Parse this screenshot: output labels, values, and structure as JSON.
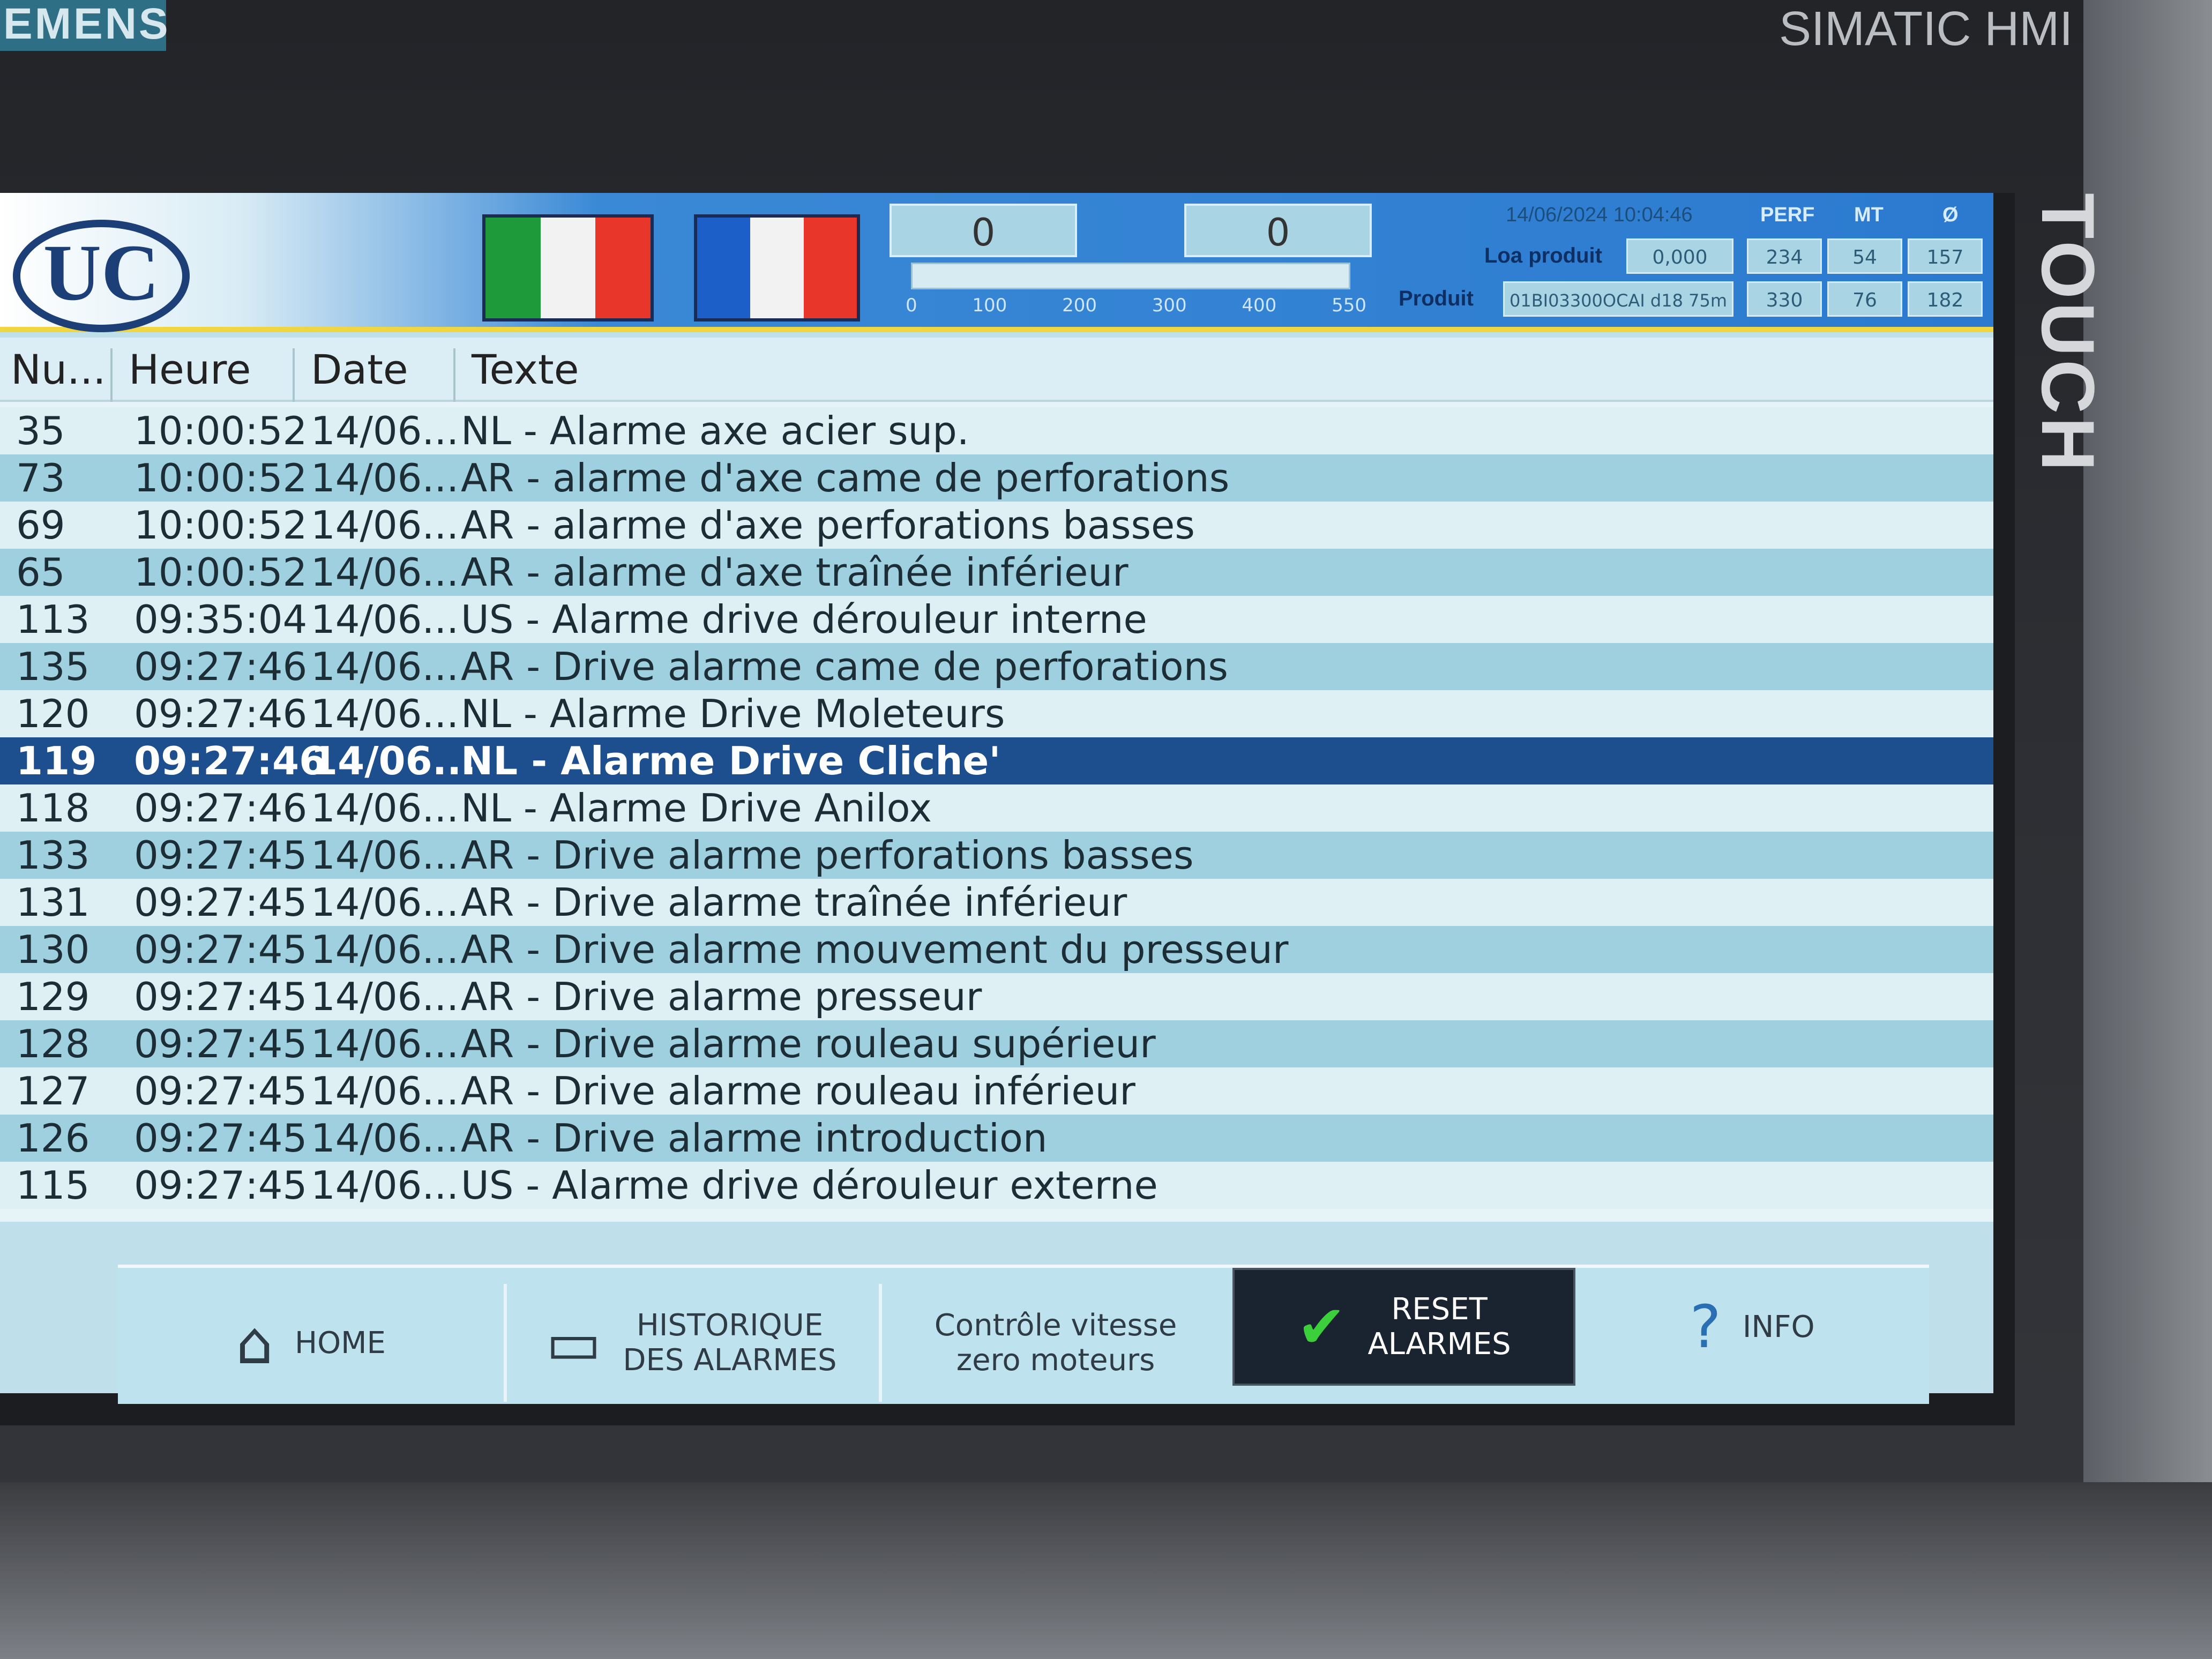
{
  "device": {
    "brand_left": "EMENS",
    "brand_right": "SIMATIC HMI",
    "touch_label": "TOUCH"
  },
  "header": {
    "logo_text": "UC",
    "counters": [
      "0",
      "0"
    ],
    "scale_ticks": [
      "0",
      "100",
      "200",
      "300",
      "400",
      "550"
    ],
    "datetime": "14/06/2024 10:04:46",
    "col_labels": [
      "PERF",
      "MT",
      "Ø"
    ],
    "loa_label": "Loa produit",
    "loa_value": "0,000",
    "produit_label": "Produit",
    "produit_value": "01BI03300OCAI d18 75m",
    "row1": [
      "234",
      "54",
      "157"
    ],
    "row2": [
      "330",
      "76",
      "182"
    ],
    "flag_colors": {
      "it": [
        "#1f9a3a",
        "#f2f2f2",
        "#e8372a"
      ],
      "fr": [
        "#1d5fc9",
        "#f2f2f2",
        "#e8372a"
      ]
    }
  },
  "table": {
    "columns": [
      "Nu...",
      "Heure",
      "Date",
      "Texte"
    ],
    "selected_index": 7,
    "rows": [
      {
        "num": "35",
        "time": "10:00:52",
        "date": "14/06...",
        "text": "NL - Alarme axe acier sup."
      },
      {
        "num": "73",
        "time": "10:00:52",
        "date": "14/06...",
        "text": "AR - alarme d'axe came de perforations"
      },
      {
        "num": "69",
        "time": "10:00:52",
        "date": "14/06...",
        "text": "AR - alarme d'axe perforations basses"
      },
      {
        "num": "65",
        "time": "10:00:52",
        "date": "14/06...",
        "text": "AR - alarme d'axe  traînée inférieur"
      },
      {
        "num": "113",
        "time": "09:35:04",
        "date": "14/06...",
        "text": "US - Alarme drive dérouleur interne"
      },
      {
        "num": "135",
        "time": "09:27:46",
        "date": "14/06...",
        "text": "AR - Drive alarme came de perforations"
      },
      {
        "num": "120",
        "time": "09:27:46",
        "date": "14/06...",
        "text": "NL - Alarme Drive  Moleteurs"
      },
      {
        "num": "119",
        "time": "09:27:46",
        "date": "14/06...",
        "text": "NL - Alarme Drive Cliche'"
      },
      {
        "num": "118",
        "time": "09:27:46",
        "date": "14/06...",
        "text": "NL - Alarme Drive Anilox"
      },
      {
        "num": "133",
        "time": "09:27:45",
        "date": "14/06...",
        "text": "AR - Drive alarme perforations basses"
      },
      {
        "num": "131",
        "time": "09:27:45",
        "date": "14/06...",
        "text": "AR - Drive alarme traînée inférieur"
      },
      {
        "num": "130",
        "time": "09:27:45",
        "date": "14/06...",
        "text": "AR - Drive alarme mouvement du presseur"
      },
      {
        "num": "129",
        "time": "09:27:45",
        "date": "14/06...",
        "text": "AR - Drive alarme presseur"
      },
      {
        "num": "128",
        "time": "09:27:45",
        "date": "14/06...",
        "text": "AR - Drive alarme rouleau supérieur"
      },
      {
        "num": "127",
        "time": "09:27:45",
        "date": "14/06...",
        "text": "AR - Drive alarme rouleau inférieur"
      },
      {
        "num": "126",
        "time": "09:27:45",
        "date": "14/06...",
        "text": "AR - Drive alarme introduction"
      },
      {
        "num": "115",
        "time": "09:27:45",
        "date": "14/06...",
        "text": "US - Alarme drive dérouleur externe"
      }
    ]
  },
  "nav": {
    "home": "HOME",
    "historique_line1": "HISTORIQUE",
    "historique_line2": "DES ALARMES",
    "controle_line1": "Contrôle vitesse",
    "controle_line2": "zero moteurs",
    "reset_line1": "RESET",
    "reset_line2": "ALARMES",
    "info": "INFO"
  }
}
